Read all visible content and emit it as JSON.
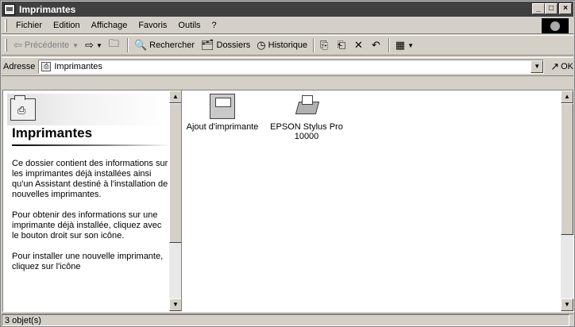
{
  "window": {
    "title": "Imprimantes",
    "controls": {
      "minimize": "_",
      "maximize": "□",
      "close": "×"
    }
  },
  "menubar": {
    "items": [
      {
        "label": "Fichier"
      },
      {
        "label": "Edition"
      },
      {
        "label": "Affichage"
      },
      {
        "label": "Favoris"
      },
      {
        "label": "Outils"
      },
      {
        "label": "?"
      }
    ]
  },
  "toolbar": {
    "back_label": "Précédente",
    "search_label": "Rechercher",
    "folders_label": "Dossiers",
    "history_label": "Historique"
  },
  "address": {
    "label": "Adresse",
    "value": "Imprimantes",
    "go_label": "OK"
  },
  "left_pane": {
    "title": "Imprimantes",
    "paragraphs": [
      "Ce dossier contient des informations sur les imprimantes déjà installées ainsi qu'un Assistant destiné à l'installation de nouvelles imprimantes.",
      "Pour obtenir des informations sur une imprimante déjà installée, cliquez avec le bouton droit sur son icône.",
      "Pour installer une nouvelle imprimante, cliquez sur l'icône"
    ]
  },
  "files": [
    {
      "name": "Ajout d'imprimante",
      "icon": "add-printer-icon"
    },
    {
      "name": "EPSON Stylus Pro 10000",
      "icon": "printer-icon"
    }
  ],
  "status": {
    "text": "3 objet(s)"
  }
}
